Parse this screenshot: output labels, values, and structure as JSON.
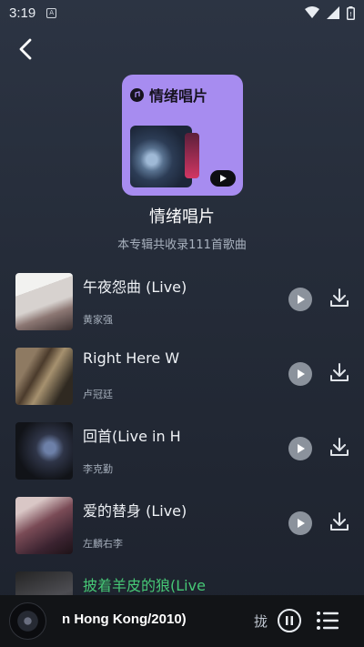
{
  "status": {
    "time": "3:19"
  },
  "header": {
    "back_icon": "back-chevron-icon"
  },
  "album": {
    "cover_label": "情绪唱片",
    "title": "情绪唱片",
    "subtitle": "本专辑共收录111首歌曲"
  },
  "songs": [
    {
      "title": "午夜怨曲 (Live)",
      "artist": "黄家强"
    },
    {
      "title": "Right Here W",
      "artist": "卢冠廷"
    },
    {
      "title": "回首(Live in H",
      "artist": "李克勤"
    },
    {
      "title": "爱的替身 (Live)",
      "artist": "左麟右李"
    },
    {
      "title": "披着羊皮的狼(Live",
      "artist": "",
      "active": true
    }
  ],
  "mini_player": {
    "title": "n Hong Kong/2010)",
    "glyph": "拢"
  },
  "colors": {
    "accent_green": "#46c876",
    "cover_purple": "#a78cf0"
  }
}
